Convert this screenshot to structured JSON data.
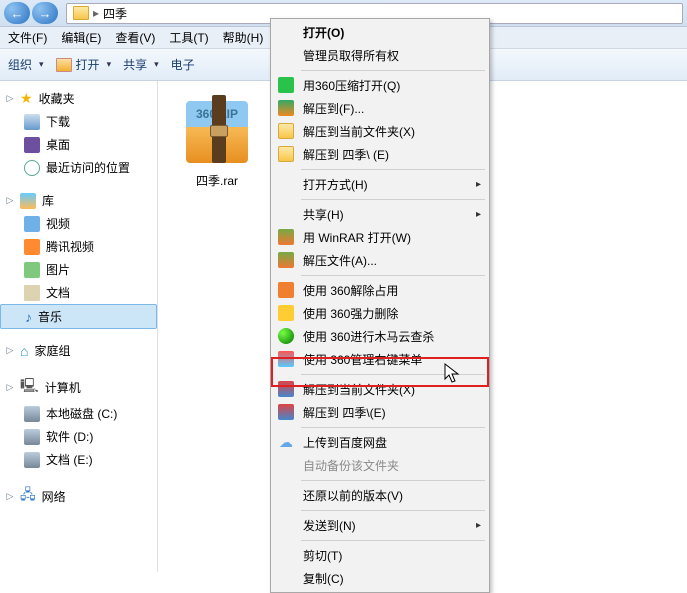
{
  "breadcrumb": {
    "folder": "四季"
  },
  "menus": {
    "file": "文件(F)",
    "edit": "编辑(E)",
    "view": "查看(V)",
    "tools": "工具(T)",
    "help": "帮助(H)"
  },
  "toolbar": {
    "organize": "组织",
    "open": "打开",
    "share": "共享",
    "email": "电子"
  },
  "sidebar": {
    "fav": {
      "head": "收藏夹",
      "items": [
        "下载",
        "桌面",
        "最近访问的位置"
      ]
    },
    "lib": {
      "head": "库",
      "items": [
        "视频",
        "腾讯视频",
        "图片",
        "文档",
        "音乐"
      ]
    },
    "home": {
      "head": "家庭组"
    },
    "comp": {
      "head": "计算机",
      "items": [
        "本地磁盘 (C:)",
        "软件 (D:)",
        "文档 (E:)"
      ]
    },
    "net": {
      "head": "网络"
    }
  },
  "file": {
    "name": "四季.rar",
    "badge": "360\nZIP"
  },
  "ctx": [
    {
      "label": "打开(O)",
      "bold": true
    },
    {
      "label": "管理员取得所有权"
    },
    {
      "sep": true
    },
    {
      "label": "用360压缩打开(Q)",
      "icon": "ic-360"
    },
    {
      "label": "解压到(F)...",
      "icon": "ic-rar"
    },
    {
      "label": "解压到当前文件夹(X)",
      "icon": "ic-folder"
    },
    {
      "label": "解压到 四季\\ (E)",
      "icon": "ic-folder"
    },
    {
      "sep": true
    },
    {
      "label": "打开方式(H)",
      "sub": true
    },
    {
      "sep": true
    },
    {
      "label": "共享(H)",
      "sub": true
    },
    {
      "label": "用 WinRAR 打开(W)",
      "icon": "ic-winrar"
    },
    {
      "label": "解压文件(A)...",
      "icon": "ic-winrar"
    },
    {
      "sep": true
    },
    {
      "label": "使用 360解除占用",
      "icon": "ic-orange"
    },
    {
      "label": "使用 360强力删除",
      "icon": "ic-shield"
    },
    {
      "label": "使用 360进行木马云查杀",
      "icon": "ic-ball"
    },
    {
      "label": "使用 360管理右键菜单",
      "icon": "ic-grid"
    },
    {
      "sep": true
    },
    {
      "label": "解压到当前文件夹(X)",
      "icon": "ic-rar2",
      "hl": true
    },
    {
      "label": "解压到 四季\\(E)",
      "icon": "ic-rar2"
    },
    {
      "sep": true
    },
    {
      "label": "上传到百度网盘",
      "icon": "ic-cloud"
    },
    {
      "label": "自动备份该文件夹",
      "disabled": true
    },
    {
      "sep": true
    },
    {
      "label": "还原以前的版本(V)"
    },
    {
      "sep": true
    },
    {
      "label": "发送到(N)",
      "sub": true
    },
    {
      "sep": true
    },
    {
      "label": "剪切(T)"
    },
    {
      "label": "复制(C)"
    }
  ]
}
